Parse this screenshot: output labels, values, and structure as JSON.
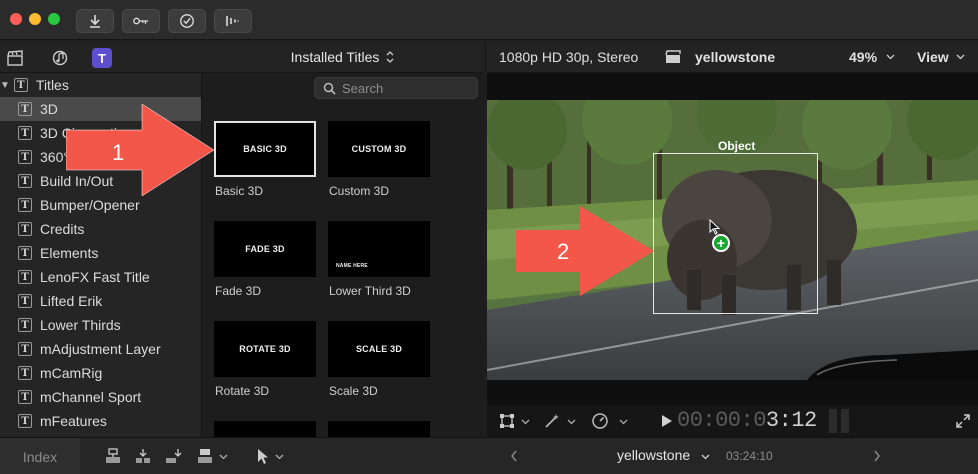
{
  "toolbar": {
    "buttons": [
      {
        "icon": "import-arrow-icon"
      },
      {
        "icon": "key-icon"
      },
      {
        "icon": "checkmark-circle-icon"
      },
      {
        "icon": "background-tasks-icon"
      }
    ]
  },
  "library_icons": [
    "clapboard-icon",
    "music-photos-icon",
    "titles-generators-icon"
  ],
  "browser": {
    "title": "Installed Titles",
    "search_placeholder": "Search",
    "tiles": [
      {
        "thumb": "BASIC 3D",
        "label": "Basic 3D",
        "selected": true
      },
      {
        "thumb": "CUSTOM 3D",
        "label": "Custom 3D"
      },
      {
        "thumb": "FADE 3D",
        "label": "Fade 3D"
      },
      {
        "thumb": "NAME HERE",
        "label": "Lower Third 3D"
      },
      {
        "thumb": "ROTATE 3D",
        "label": "Rotate 3D"
      },
      {
        "thumb": "SCALE 3D",
        "label": "Scale 3D"
      }
    ]
  },
  "sidebar": {
    "root": "Titles",
    "items": [
      "3D",
      "3D Cinematic",
      "360°",
      "Build In/Out",
      "Bumper/Opener",
      "Credits",
      "Elements",
      "LenoFX Fast Title",
      "Lifted Erik",
      "Lower Thirds",
      "mAdjustment Layer",
      "mCamRig",
      "mChannel Sport",
      "mFeatures"
    ]
  },
  "viewer": {
    "format": "1080p HD 30p, Stereo",
    "clip_name": "yellowstone",
    "zoom": "49%",
    "view_menu": "View",
    "object_label": "Object",
    "timecode_dim": "00:00:0",
    "timecode_bright": "3:12"
  },
  "annotations": {
    "arrow1": "1",
    "arrow2": "2",
    "color": "#f2574a"
  },
  "bottombar": {
    "index": "Index",
    "project": "yellowstone",
    "duration": "03:24:10"
  }
}
